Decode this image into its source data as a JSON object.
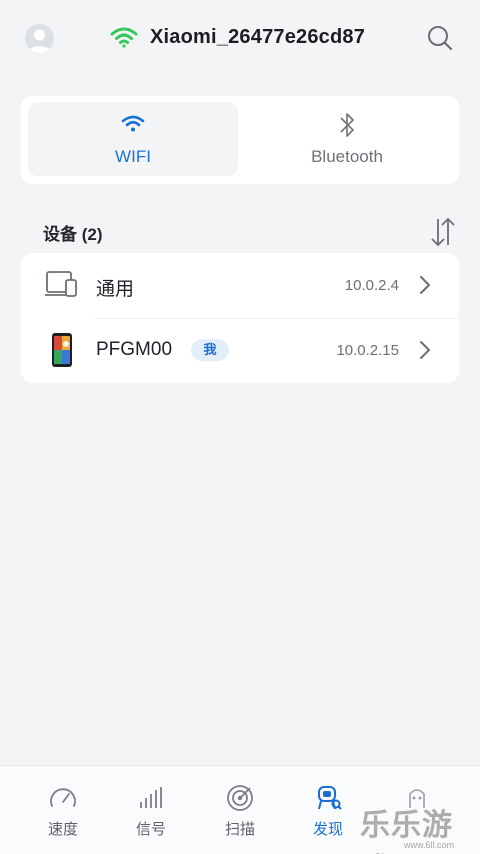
{
  "header": {
    "ssid": "Xiaomi_26477e26cd87",
    "wifi_icon": "wifi-icon",
    "wifi_color": "#34c759"
  },
  "tabs": [
    {
      "label": "WIFI",
      "icon": "wifi-icon",
      "active": true
    },
    {
      "label": "Bluetooth",
      "icon": "bluetooth-icon",
      "active": false
    }
  ],
  "devices": {
    "title": "设备 (2)",
    "items": [
      {
        "name": "通用",
        "ip": "10.0.2.4",
        "icon": "computer-device-icon"
      },
      {
        "name": "PFGM00",
        "badge": "我",
        "ip": "10.0.2.15",
        "icon": "phone-device-icon"
      }
    ]
  },
  "bottom_nav": [
    {
      "label": "速度",
      "icon": "speedometer-icon",
      "active": false
    },
    {
      "label": "信号",
      "icon": "signal-bars-icon",
      "active": false
    },
    {
      "label": "扫描",
      "icon": "radar-icon",
      "active": false
    },
    {
      "label": "发现",
      "icon": "discover-robot-icon",
      "active": true
    },
    {
      "label": "",
      "icon": "more-icon",
      "active": false
    }
  ],
  "watermark": {
    "text": "乐乐游戏",
    "url": "www.6ll.com"
  },
  "colors": {
    "accent": "#1a72d8",
    "background": "#f3f4f6",
    "card": "#ffffff"
  }
}
